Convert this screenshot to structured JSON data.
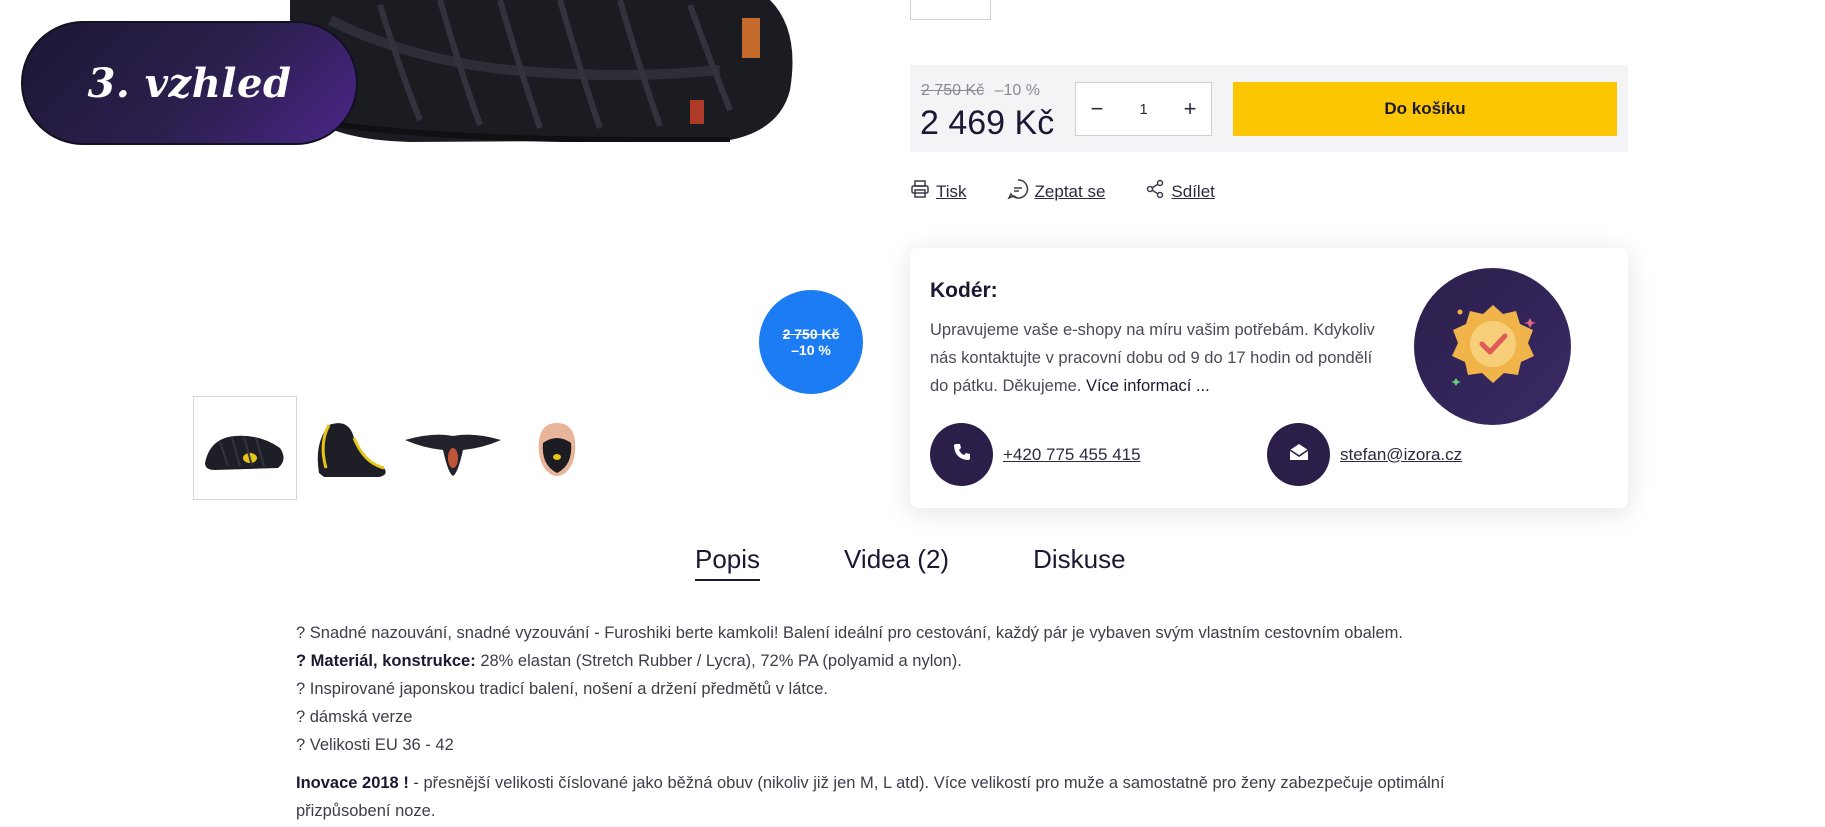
{
  "badge": {
    "label": "3. vzhled"
  },
  "discount_circle": {
    "old_price": "2 750 Kč",
    "discount": "–10 %"
  },
  "price": {
    "old_price": "2 750 Kč",
    "discount": "–10 %",
    "new_price": "2 469 Kč"
  },
  "quantity": {
    "value": "1",
    "minus": "−",
    "plus": "+"
  },
  "cart_button": {
    "label": "Do košíku",
    "color": "#fdc602"
  },
  "actions": [
    {
      "label": "Tisk",
      "icon": "printer-icon"
    },
    {
      "label": "Zeptat se",
      "icon": "chat-icon"
    },
    {
      "label": "Sdílet",
      "icon": "share-icon"
    }
  ],
  "coder": {
    "title": "Kodér:",
    "text": "Upravujeme vaše e-shopy na míru vašim potřebám. Kdykoliv nás kontaktujte v pracovní dobu od 9 do 17 hodin od pondělí do pátku. Děkujeme.",
    "more": "Více informací ...",
    "avatar_icon": "verified-badge-icon",
    "phone": "+420 775 455 415",
    "email": "stefan@izora.cz"
  },
  "tabs": [
    {
      "label": "Popis",
      "active": true
    },
    {
      "label": "Videa (2)",
      "active": false
    },
    {
      "label": "Diskuse",
      "active": false
    }
  ],
  "description": {
    "lines": [
      {
        "bold": "",
        "text": "? Snadné nazouvání, snadné vyzouvání - Furoshiki berte kamkoli! Balení ideální pro cestování, každý pár je vybaven svým vlastním cestovním obalem."
      },
      {
        "bold": "? Materiál, konstrukce:",
        "text": " 28% elastan (Stretch Rubber / Lycra), 72% PA (polyamid a nylon)."
      },
      {
        "bold": "",
        "text": "? Inspirované japonskou tradicí balení, nošení a držení předmětů v látce."
      },
      {
        "bold": "",
        "text": "? dámská verze"
      },
      {
        "bold": "",
        "text": "? Velikosti EU 36 - 42"
      }
    ],
    "innovation_bold": "Inovace 2018 !",
    "innovation_text": " - přesnější velikosti číslované jako běžná obuv (nikoliv již jen M, L atd). Více velikostí pro muže a samostatně pro ženy zabezpečuje optimální přizpůsobení noze."
  },
  "colors": {
    "brand_dark": "#2b1f4a",
    "discount_blue": "#1c7cf4",
    "cart_yellow": "#fdc602"
  }
}
